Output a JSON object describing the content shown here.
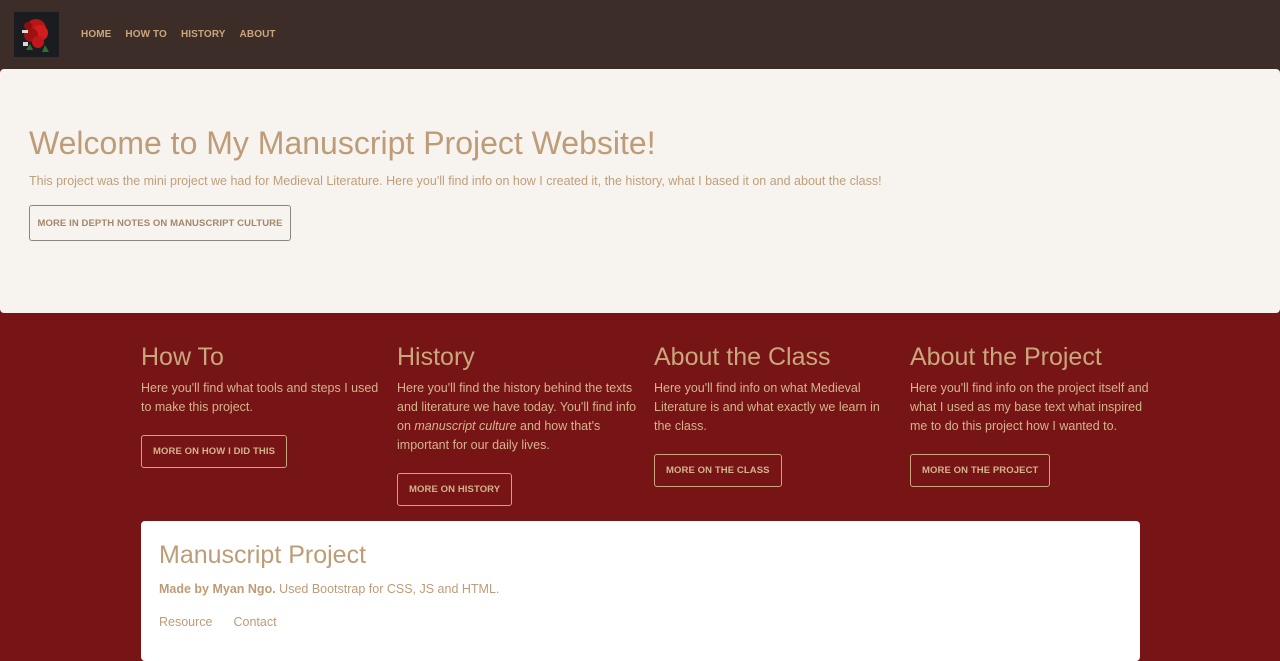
{
  "nav": {
    "logo_alt": "site logo",
    "items": [
      {
        "label": "HOME"
      },
      {
        "label": "HOW TO"
      },
      {
        "label": "HISTORY"
      },
      {
        "label": "ABOUT"
      }
    ]
  },
  "hero": {
    "title": "Welcome to My Manuscript Project Website!",
    "subtitle": "This project was the mini project we had for Medieval Literature. Here you'll find info on how I created it, the history, what I based it on and about the class!",
    "button_label": "MORE IN DEPTH NOTES ON MANUSCRIPT CULTURE"
  },
  "sections": [
    {
      "title": "How To",
      "text": "Here you'll find what tools and steps I used to make this project.",
      "button_label": "MORE ON HOW I DID THIS"
    },
    {
      "title": "History",
      "text_before": "Here you'll find the history behind the texts and literature we have today. You'll find info on ",
      "text_em": "manuscript culture",
      "text_after": " and how that's important for our daily lives.",
      "button_label": "MORE ON HISTORY"
    },
    {
      "title": "About the Class",
      "text": "Here you'll find info on what Medieval Literature is and what exactly we learn in the class.",
      "button_label": "MORE ON THE CLASS"
    },
    {
      "title": "About the Project",
      "text": "Here you'll find info on the project itself and what I used as my base text what inspired me to do this project how I wanted to.",
      "button_label": "MORE ON THE PROJECT"
    }
  ],
  "footer": {
    "title": "Manuscript Project",
    "made_by": "Made by Myan Ngo.",
    "made_rest": " Used Bootstrap for CSS, JS and HTML.",
    "links": [
      {
        "label": "Resource"
      },
      {
        "label": "Contact"
      }
    ]
  },
  "colors": {
    "navbar_bg": "#3d2d28",
    "page_bg": "#771415",
    "hero_bg": "#f7f3ef",
    "accent_tan": "#c9a67b"
  }
}
